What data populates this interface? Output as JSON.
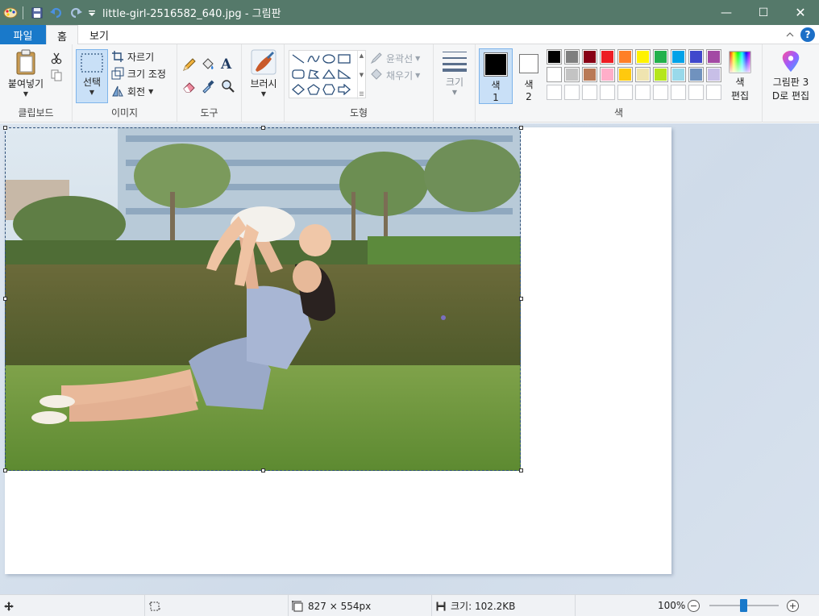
{
  "window": {
    "title": "little-girl-2516582_640.jpg - 그림판",
    "minimize_glyph": "—",
    "maximize_glyph": "☐",
    "close_glyph": "✕"
  },
  "tabs": {
    "file": "파일",
    "home": "홈",
    "view": "보기"
  },
  "ribbon": {
    "clipboard": {
      "paste": "붙여넣기",
      "group": "클립보드"
    },
    "image": {
      "select": "선택",
      "crop": "자르기",
      "resize": "크기 조정",
      "rotate": "회전",
      "group": "이미지"
    },
    "tools": {
      "group": "도구",
      "text_glyph": "A"
    },
    "brushes": {
      "label": "브러시"
    },
    "shapes": {
      "outline": "윤곽선",
      "fill": "채우기",
      "group": "도형"
    },
    "size": {
      "label": "크기"
    },
    "colors": {
      "color1": "색",
      "color1_num": "1",
      "color2": "색",
      "color2_num": "2",
      "edit_colors_1": "색",
      "edit_colors_2": "편집",
      "group": "색",
      "color1_value": "#000000",
      "color2_value": "#ffffff",
      "palette_row1": [
        "#000000",
        "#7f7f7f",
        "#880015",
        "#ed1c24",
        "#ff7f27",
        "#fff200",
        "#22b14c",
        "#00a2e8",
        "#3f48cc",
        "#a349a4"
      ],
      "palette_row2": [
        "#ffffff",
        "#c3c3c3",
        "#b97a57",
        "#ffaec9",
        "#ffc90e",
        "#efe4b0",
        "#b5e61d",
        "#99d9ea",
        "#7092be",
        "#c8bfe7"
      ],
      "palette_row3": [
        "#ffffff",
        "#ffffff",
        "#ffffff",
        "#ffffff",
        "#ffffff",
        "#ffffff",
        "#ffffff",
        "#ffffff",
        "#ffffff",
        "#ffffff"
      ]
    },
    "paint3d": {
      "line1": "그림판 3",
      "line2": "D로 편집"
    }
  },
  "status": {
    "dimensions": "827 × 554px",
    "size": "크기: 102.2KB",
    "zoom": "100%",
    "zoom_level_percent": 100
  }
}
